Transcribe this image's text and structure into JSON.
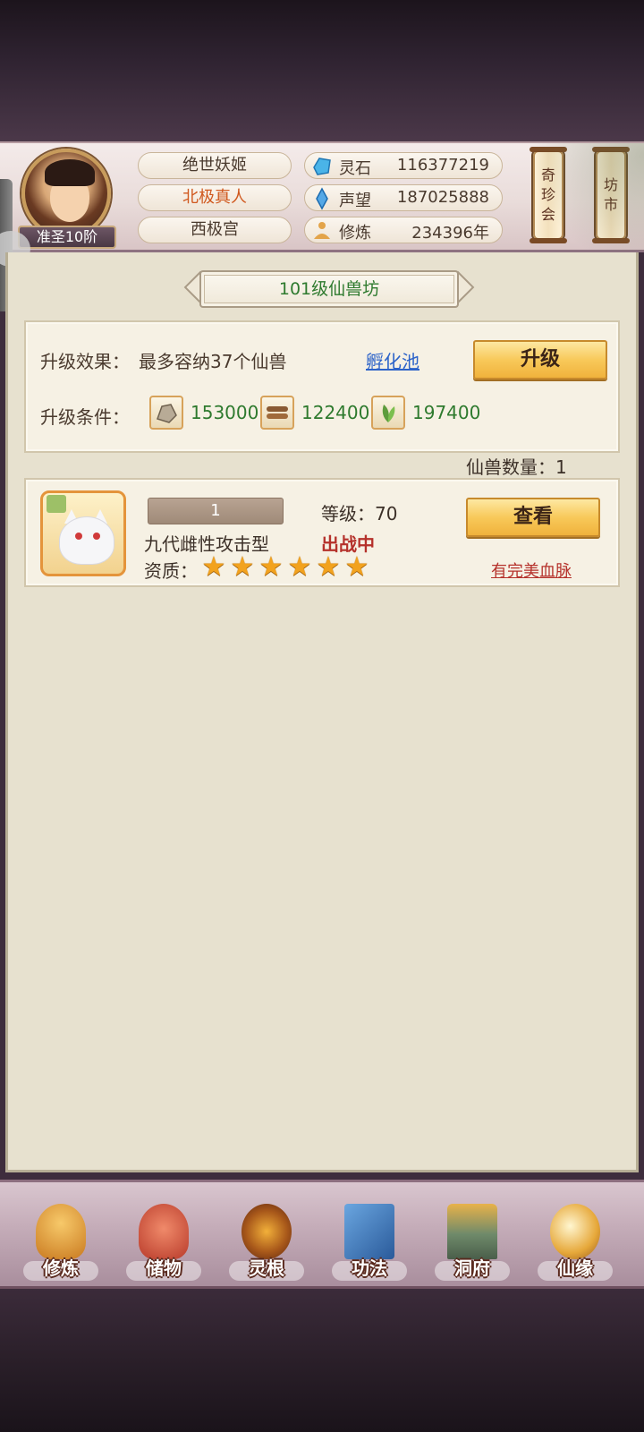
{
  "header": {
    "rank": "准圣10阶",
    "title1": "绝世妖姬",
    "title2": "北极真人",
    "title3": "西极宫",
    "stats": [
      {
        "icon": "spirit-stone-icon",
        "label": "灵石",
        "value": "116377219"
      },
      {
        "icon": "reputation-crystal-icon",
        "label": "声望",
        "value": "187025888"
      },
      {
        "icon": "meditation-icon",
        "label": "修炼",
        "value": "234396年"
      }
    ],
    "btn_treasure": [
      "奇",
      "珍",
      "会"
    ],
    "btn_market": [
      "坊",
      "市"
    ]
  },
  "panel": {
    "title": "101级仙兽坊",
    "effect_label": "升级效果：",
    "effect_value": "最多容纳37个仙兽",
    "hatch_link": "孵化池",
    "upgrade_button": "升级",
    "cond_label": "升级条件：",
    "resources": [
      {
        "icon": "ore-icon",
        "value": "153000"
      },
      {
        "icon": "wood-icon",
        "value": "122400"
      },
      {
        "icon": "herb-icon",
        "value": "197400"
      }
    ],
    "beast_count": "仙兽数量：1"
  },
  "beast": {
    "number": "1",
    "name": "九代雌性攻击型",
    "level": "等级：70",
    "status": "出战中",
    "quality_label": "资质：",
    "stars": 6,
    "view_button": "查看",
    "perfect_link": "有完美血脉"
  },
  "nav": [
    "修炼",
    "储物",
    "灵根",
    "功法",
    "洞府",
    "仙缘"
  ],
  "colors": {
    "green_text": "#2e7a2e",
    "link_blue": "#2c63c9",
    "status_red": "#b5312b",
    "button_gold": "#f8c95a"
  }
}
